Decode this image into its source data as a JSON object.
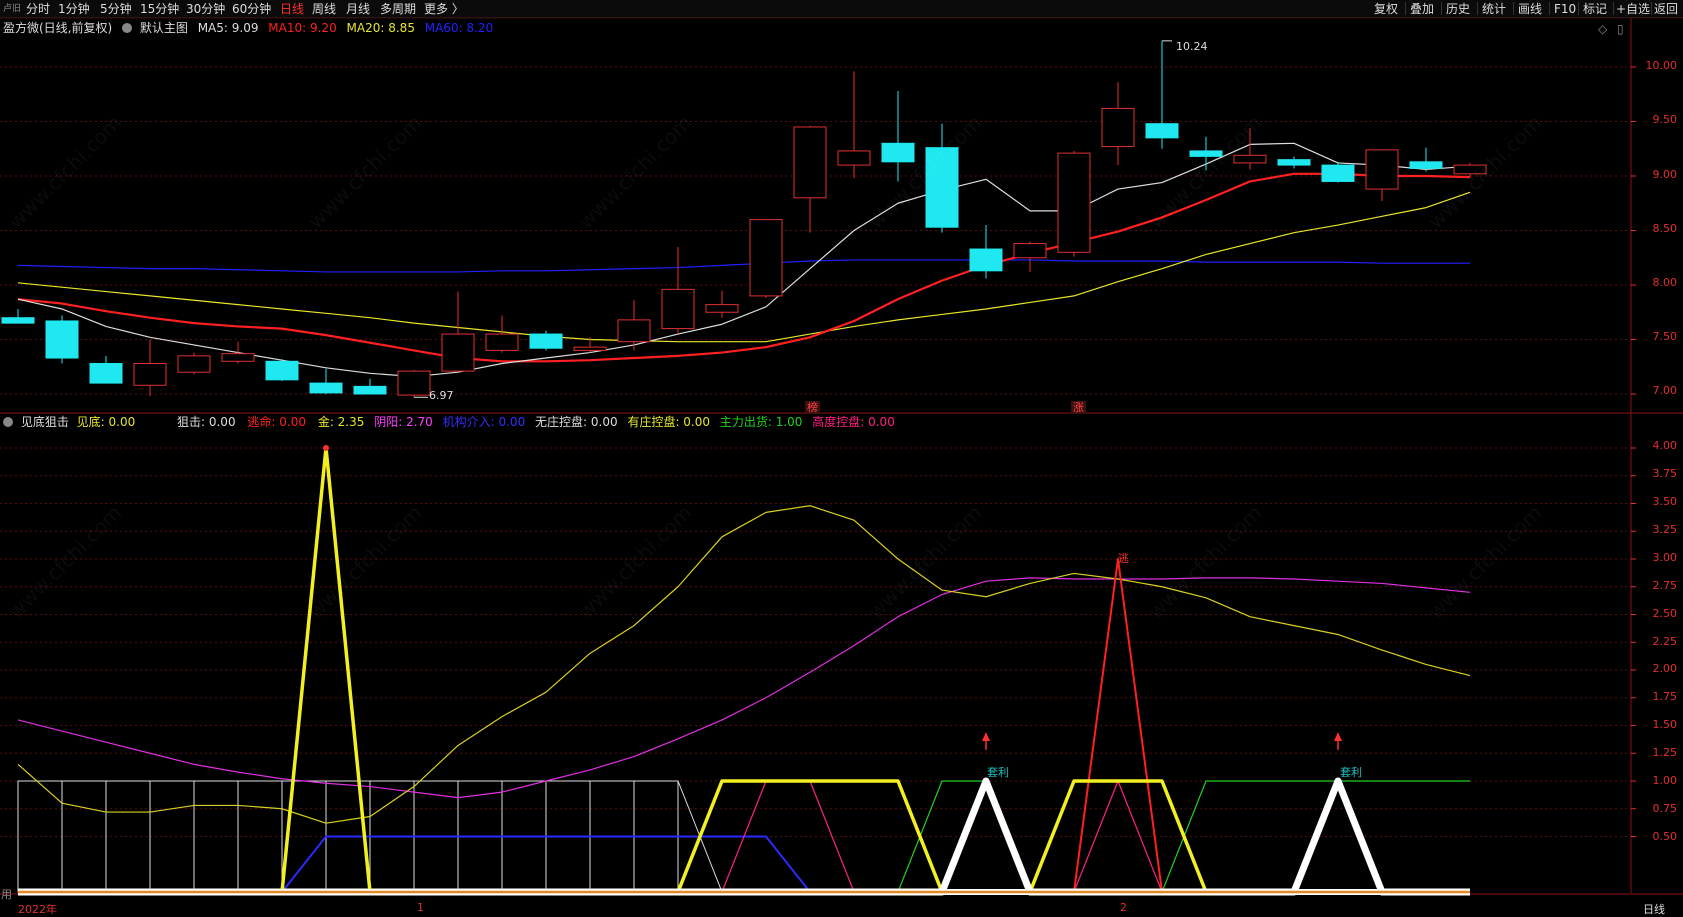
{
  "toolbar": {
    "corner": "卢旧",
    "periods": [
      "分时",
      "1分钟",
      "5分钟",
      "15分钟",
      "30分钟",
      "60分钟",
      "日线",
      "周线",
      "月线",
      "多周期",
      "更多 〉"
    ],
    "active_period": "日线",
    "right": [
      "复权",
      "叠加",
      "历史",
      "统计",
      "画线",
      "F10",
      "标记",
      "+自选",
      "返回"
    ]
  },
  "main_legend": {
    "title": "盈方微(日线,前复权)",
    "template": "默认主图",
    "ma5": "MA5: 9.09",
    "ma10": "MA10: 9.20",
    "ma20": "MA20: 8.85",
    "ma60": "MA60: 8.20"
  },
  "colors": {
    "ma5": "#dddddd",
    "ma10": "#ff2020",
    "ma20": "#e6e62a",
    "ma60": "#2020ff",
    "up": "#e03030",
    "down": "#20e8f0",
    "axis": "#e03030",
    "grid": "#5a0d0d"
  },
  "price_axis": [
    "10.00",
    "9.50",
    "9.00",
    "8.50",
    "8.00",
    "7.50",
    "7.00"
  ],
  "price_annotations": {
    "high": "10.24",
    "low": "6.97"
  },
  "top_marks": {
    "mark1": "榜",
    "mark2": "涨"
  },
  "indicator_legend": {
    "title": "见底狙击",
    "items": [
      {
        "text": "见底: 0.00",
        "color": "#e6e62a"
      },
      {
        "text": "狙击: 0.00",
        "color": "#dddddd"
      },
      {
        "text": "逃命: 0.00",
        "color": "#ff2020"
      },
      {
        "text": "金: 2.35",
        "color": "#e6e62a"
      },
      {
        "text": "阴阳: 2.70",
        "color": "#ff40ff"
      },
      {
        "text": "机构介入: 0.00",
        "color": "#3030ff"
      },
      {
        "text": "无庄控盘: 0.00",
        "color": "#dddddd"
      },
      {
        "text": "有庄控盘: 0.00",
        "color": "#e6e62a"
      },
      {
        "text": "主力出货: 1.00",
        "color": "#20d020"
      },
      {
        "text": "高度控盘: 0.00",
        "color": "#ff2080"
      }
    ]
  },
  "indicator_axis": [
    "4.00",
    "3.75",
    "3.50",
    "3.25",
    "3.00",
    "2.75",
    "2.50",
    "2.25",
    "2.00",
    "1.75",
    "1.50",
    "1.25",
    "1.00",
    "0.75",
    "0.50"
  ],
  "indicator_marks": {
    "tao": "逃",
    "taoli": "套利"
  },
  "bottom_axis": {
    "year": "2022年",
    "m1": "1",
    "m2": "2",
    "corner": "用",
    "right_tab": "日线"
  },
  "watermark": "www.cfchi.com",
  "chart_data": {
    "type": "candlestick",
    "price_ylim": [
      6.85,
      10.35
    ],
    "indicator_ylim": [
      0,
      4.2
    ],
    "candles": [
      {
        "o": 7.7,
        "h": 7.78,
        "l": 7.65,
        "c": 7.65
      },
      {
        "o": 7.67,
        "h": 7.72,
        "l": 7.28,
        "c": 7.33
      },
      {
        "o": 7.28,
        "h": 7.35,
        "l": 7.1,
        "c": 7.1
      },
      {
        "o": 7.08,
        "h": 7.5,
        "l": 6.98,
        "c": 7.28
      },
      {
        "o": 7.2,
        "h": 7.38,
        "l": 7.18,
        "c": 7.35
      },
      {
        "o": 7.3,
        "h": 7.48,
        "l": 7.28,
        "c": 7.37
      },
      {
        "o": 7.3,
        "h": 7.32,
        "l": 7.12,
        "c": 7.13
      },
      {
        "o": 7.1,
        "h": 7.23,
        "l": 7.0,
        "c": 7.01
      },
      {
        "o": 7.07,
        "h": 7.14,
        "l": 7.0,
        "c": 7.0
      },
      {
        "o": 6.99,
        "h": 7.22,
        "l": 6.97,
        "c": 7.21
      },
      {
        "o": 7.21,
        "h": 7.94,
        "l": 7.2,
        "c": 7.55
      },
      {
        "o": 7.4,
        "h": 7.72,
        "l": 7.38,
        "c": 7.55
      },
      {
        "o": 7.55,
        "h": 7.58,
        "l": 7.4,
        "c": 7.42
      },
      {
        "o": 7.4,
        "h": 7.52,
        "l": 7.38,
        "c": 7.43
      },
      {
        "o": 7.48,
        "h": 7.86,
        "l": 7.4,
        "c": 7.68
      },
      {
        "o": 7.6,
        "h": 8.35,
        "l": 7.55,
        "c": 7.96
      },
      {
        "o": 7.75,
        "h": 7.95,
        "l": 7.7,
        "c": 7.82
      },
      {
        "o": 7.9,
        "h": 8.6,
        "l": 7.88,
        "c": 8.6
      },
      {
        "o": 8.8,
        "h": 9.46,
        "l": 8.48,
        "c": 9.45
      },
      {
        "o": 9.1,
        "h": 9.96,
        "l": 8.98,
        "c": 9.23
      },
      {
        "o": 9.3,
        "h": 9.78,
        "l": 8.95,
        "c": 9.13
      },
      {
        "o": 9.26,
        "h": 9.48,
        "l": 8.48,
        "c": 8.53
      },
      {
        "o": 8.33,
        "h": 8.55,
        "l": 8.06,
        "c": 8.13
      },
      {
        "o": 8.25,
        "h": 8.4,
        "l": 8.12,
        "c": 8.38
      },
      {
        "o": 8.3,
        "h": 9.23,
        "l": 8.26,
        "c": 9.21
      },
      {
        "o": 9.27,
        "h": 9.86,
        "l": 9.1,
        "c": 9.62
      },
      {
        "o": 9.48,
        "h": 10.24,
        "l": 9.25,
        "c": 9.35
      },
      {
        "o": 9.23,
        "h": 9.36,
        "l": 9.05,
        "c": 9.18
      },
      {
        "o": 9.12,
        "h": 9.44,
        "l": 9.06,
        "c": 9.19
      },
      {
        "o": 9.15,
        "h": 9.18,
        "l": 9.07,
        "c": 9.1
      },
      {
        "o": 9.1,
        "h": 9.13,
        "l": 8.94,
        "c": 8.95
      },
      {
        "o": 8.88,
        "h": 9.24,
        "l": 8.77,
        "c": 9.24
      },
      {
        "o": 9.13,
        "h": 9.26,
        "l": 9.04,
        "c": 9.07
      },
      {
        "o": 9.02,
        "h": 9.12,
        "l": 8.99,
        "c": 9.1
      }
    ],
    "ma5": [
      7.87,
      7.78,
      7.62,
      7.52,
      7.45,
      7.38,
      7.31,
      7.24,
      7.19,
      7.16,
      7.2,
      7.28,
      7.33,
      7.38,
      7.45,
      7.55,
      7.64,
      7.8,
      8.15,
      8.5,
      8.75,
      8.87,
      8.97,
      8.68,
      8.68,
      8.88,
      8.94,
      9.11,
      9.29,
      9.3,
      9.12,
      9.1,
      9.06,
      9.09
    ],
    "ma10": [
      7.87,
      7.83,
      7.76,
      7.7,
      7.65,
      7.62,
      7.6,
      7.54,
      7.47,
      7.4,
      7.33,
      7.3,
      7.3,
      7.31,
      7.33,
      7.35,
      7.38,
      7.43,
      7.52,
      7.67,
      7.87,
      8.04,
      8.18,
      8.29,
      8.39,
      8.49,
      8.62,
      8.78,
      8.95,
      9.02,
      9.02,
      9.0,
      9.0,
      8.99,
      9.04,
      9.12,
      9.2
    ],
    "ma20": [
      8.02,
      7.98,
      7.94,
      7.9,
      7.86,
      7.82,
      7.78,
      7.74,
      7.7,
      7.65,
      7.61,
      7.57,
      7.53,
      7.5,
      7.49,
      7.48,
      7.48,
      7.48,
      7.55,
      7.62,
      7.68,
      7.73,
      7.78,
      7.84,
      7.9,
      8.03,
      8.15,
      8.28,
      8.38,
      8.48,
      8.55,
      8.63,
      8.71,
      8.85
    ],
    "ma60": [
      8.18,
      8.17,
      8.16,
      8.15,
      8.15,
      8.14,
      8.13,
      8.12,
      8.12,
      8.12,
      8.12,
      8.13,
      8.13,
      8.14,
      8.15,
      8.16,
      8.18,
      8.2,
      8.22,
      8.23,
      8.23,
      8.23,
      8.23,
      8.23,
      8.22,
      8.22,
      8.22,
      8.21,
      8.21,
      8.21,
      8.21,
      8.2,
      8.2,
      8.2
    ],
    "series_gold": [
      1.15,
      0.8,
      0.72,
      0.72,
      0.78,
      0.78,
      0.75,
      0.62,
      0.68,
      0.95,
      1.32,
      1.58,
      1.8,
      2.15,
      2.4,
      2.75,
      3.2,
      3.42,
      3.48,
      3.35,
      3.0,
      2.72,
      2.66,
      2.78,
      2.87,
      2.82,
      2.75,
      2.65,
      2.48,
      2.4,
      2.32,
      2.18,
      2.05,
      1.95
    ],
    "series_yinyang": [
      1.55,
      1.45,
      1.35,
      1.25,
      1.15,
      1.08,
      1.02,
      0.98,
      0.95,
      0.9,
      0.85,
      0.9,
      1.0,
      1.1,
      1.22,
      1.38,
      1.55,
      1.75,
      1.98,
      2.22,
      2.48,
      2.68,
      2.8,
      2.83,
      2.82,
      2.82,
      2.82,
      2.83,
      2.83,
      2.82,
      2.8,
      2.78,
      2.74,
      2.7
    ],
    "jiandi": [
      0,
      0,
      0,
      0,
      0,
      0,
      0,
      4.0,
      0,
      0,
      0,
      0,
      0,
      0,
      0,
      0,
      0,
      0,
      0,
      0,
      0,
      0,
      0,
      0,
      0,
      0,
      0,
      0,
      0,
      0,
      0,
      0,
      0,
      0
    ],
    "taoming": [
      0,
      0,
      0,
      0,
      0,
      0,
      0,
      0,
      0,
      0,
      0,
      0,
      0,
      0,
      0,
      0,
      0,
      0,
      0,
      0,
      0,
      0,
      0,
      0,
      0,
      3.0,
      0,
      0,
      0,
      0,
      0,
      0,
      0,
      0
    ],
    "wuzhuang": [
      1,
      1,
      1,
      1,
      1,
      1,
      1,
      1,
      1,
      1,
      1,
      1,
      1,
      1,
      1,
      1,
      0,
      0,
      0,
      0,
      0,
      0,
      0,
      0,
      0,
      0,
      0,
      0,
      0,
      0,
      0,
      0,
      0,
      0
    ],
    "youzhuang": [
      0,
      0,
      0,
      0,
      0,
      0,
      0,
      0,
      0,
      0,
      0,
      0,
      0,
      0,
      0,
      0,
      1,
      1,
      1,
      1,
      1,
      0,
      0,
      0,
      1,
      1,
      1,
      0,
      0,
      0,
      0,
      0,
      0,
      0
    ],
    "jigou": [
      0,
      0,
      0,
      0,
      0,
      0,
      0,
      0.5,
      0.5,
      0.5,
      0.5,
      0.5,
      0.5,
      0.5,
      0.5,
      0.5,
      0.5,
      0.5,
      0,
      0,
      0,
      0,
      0,
      0,
      0,
      0,
      0,
      0,
      0,
      0,
      0,
      0,
      0,
      0
    ],
    "chuhuo": [
      0,
      0,
      0,
      0,
      0,
      0,
      0,
      0,
      0,
      0,
      0,
      0,
      0,
      0,
      0,
      0,
      0,
      0,
      0,
      0,
      0,
      1,
      1,
      0,
      0,
      0,
      0,
      1,
      1,
      1,
      1,
      1,
      1,
      1
    ],
    "gaodu": [
      0,
      0,
      0,
      0,
      0,
      0,
      0,
      0,
      0,
      0,
      0,
      0,
      0,
      0,
      0,
      0,
      0,
      1,
      1,
      0,
      0,
      0,
      0,
      0,
      0,
      1,
      0,
      0,
      0,
      0,
      0,
      0,
      0,
      0
    ],
    "taoli": [
      0,
      0,
      0,
      0,
      0,
      0,
      0,
      0,
      0,
      0,
      0,
      0,
      0,
      0,
      0,
      0,
      0,
      0,
      0,
      0,
      0,
      0,
      1,
      0,
      0,
      0,
      0,
      0,
      0,
      0,
      1,
      0,
      0,
      0
    ]
  }
}
